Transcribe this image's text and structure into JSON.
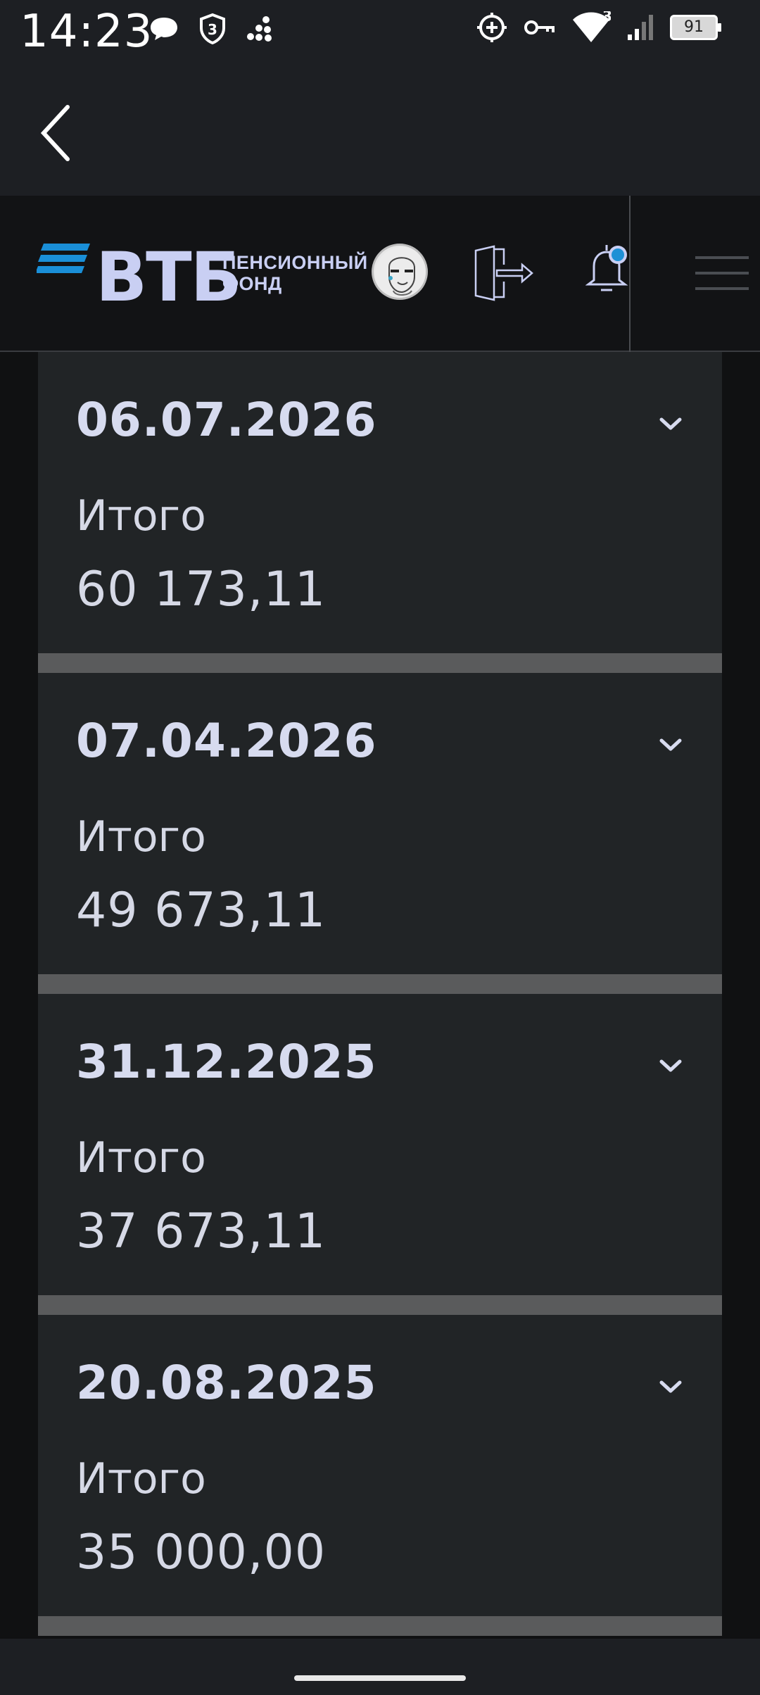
{
  "status_bar": {
    "time": "14:23",
    "battery": "91",
    "network": "3G",
    "left_icons": [
      "chat-bubble-icon",
      "shield-3-icon",
      "dots-icon"
    ],
    "right_icons": [
      "add-circle-icon",
      "key-icon",
      "wifi-icon",
      "signal-icon",
      "battery-icon"
    ]
  },
  "nav": {
    "back_icon": "chevron-left-icon"
  },
  "header": {
    "logo_text": "ВТБ",
    "logo_sub_line1": "ПЕНСИОННЫЙ",
    "logo_sub_line2": "ФОНД",
    "notification_dot_color": "#1e90d6",
    "icons": [
      "avatar",
      "logout-icon",
      "bell-icon",
      "menu-icon"
    ]
  },
  "payments": [
    {
      "date": "06.07.2026",
      "label": "Итого",
      "amount": "60 173,11"
    },
    {
      "date": "07.04.2026",
      "label": "Итого",
      "amount": "49 673,11"
    },
    {
      "date": "31.12.2025",
      "label": "Итого",
      "amount": "37 673,11"
    },
    {
      "date": "20.08.2025",
      "label": "Итого",
      "amount": "35 000,00"
    }
  ],
  "colors": {
    "accent": "#c9cff3",
    "logo_bars": "#1a8fd8",
    "card_bg": "#212426",
    "separator": "#5a5b5c"
  }
}
